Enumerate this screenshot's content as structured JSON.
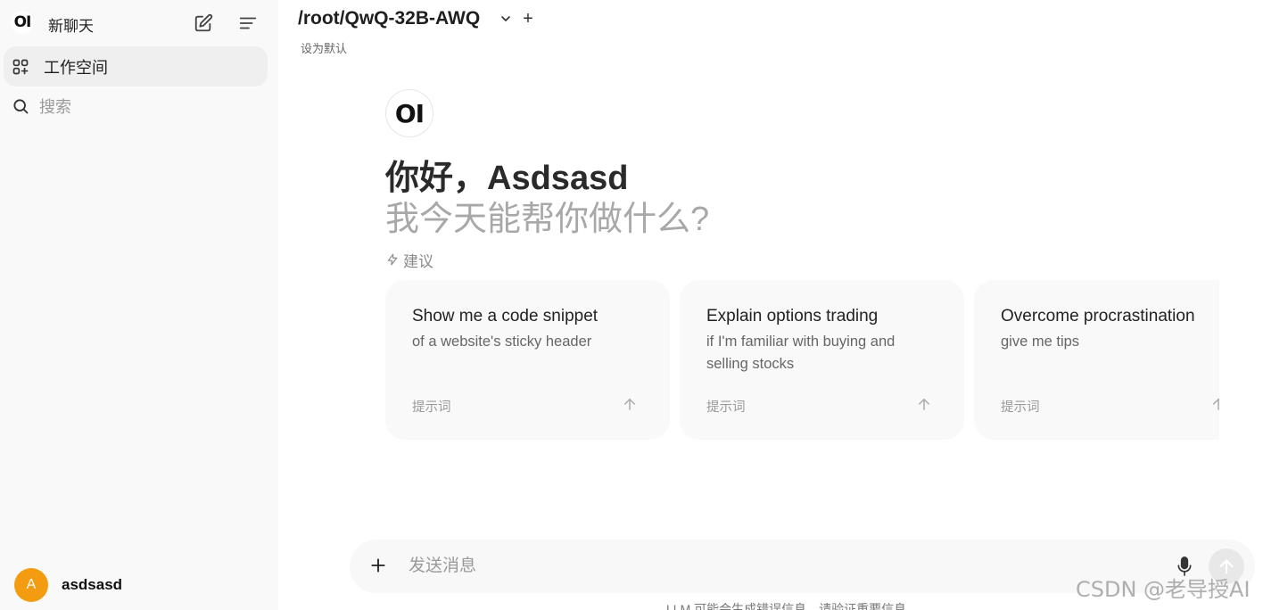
{
  "sidebar": {
    "logo_text": "OI",
    "new_chat_label": "新聊天",
    "workspace_label": "工作空间",
    "search_placeholder": "搜索",
    "user": {
      "initial": "A",
      "name": "asdsasd",
      "avatar_color": "#f39c12"
    }
  },
  "header": {
    "model_name": "/root/QwQ-32B-AWQ",
    "add_symbol": "+",
    "set_default_label": "设为默认"
  },
  "main": {
    "logo_text": "OI",
    "greeting_prefix": "你好，",
    "greeting_name": "Asdsasd",
    "subtitle": "我今天能帮你做什么?",
    "suggestions_label": "建议",
    "suggestions": [
      {
        "title": "Show me a code snippet",
        "subtitle": "of a website's sticky header",
        "tag": "提示词"
      },
      {
        "title": "Explain options trading",
        "subtitle": "if I'm familiar with buying and selling stocks",
        "tag": "提示词"
      },
      {
        "title": "Overcome procrastination",
        "subtitle": "give me tips",
        "tag": "提示词"
      }
    ]
  },
  "composer": {
    "placeholder": "发送消息",
    "disclaimer": "LLM 可能会生成错误信息。请验证重要信息。"
  },
  "watermark": "CSDN @老导授AI",
  "icons": {
    "edit": "edit-icon",
    "menu": "menu-icon",
    "workspace": "grid-plus-icon",
    "search": "search-icon",
    "chevron": "chevron-down-icon",
    "bolt": "bolt-icon",
    "arrow": "arrow-up-icon",
    "plus": "plus-icon",
    "mic": "microphone-icon",
    "send": "send-arrow-icon"
  }
}
